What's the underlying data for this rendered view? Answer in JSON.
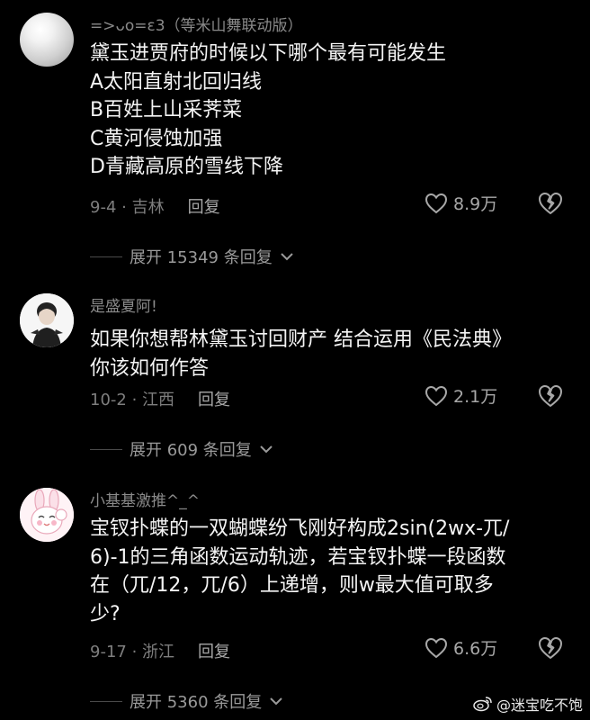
{
  "comments": [
    {
      "username": "=>ᴗo=ε3（等米山舞联动版）",
      "lines": [
        "黛玉进贾府的时候以下哪个最有可能发生",
        "A太阳直射北回归线",
        "B百姓上山采荠菜",
        "C黄河侵蚀加强",
        "D青藏高原的雪线下降"
      ],
      "date_location": "9-4 · 吉林",
      "reply_label": "回复",
      "likes": "8.9万",
      "expand_label": "展开 15349 条回复"
    },
    {
      "username": "是盛夏阿!",
      "lines": [
        "如果你想帮林黛玉讨回财产 结合运用《民法典》",
        "你该如何作答"
      ],
      "date_location": "10-2 · 江西",
      "reply_label": "回复",
      "likes": "2.1万",
      "expand_label": "展开 609 条回复"
    },
    {
      "username": "小基基激推^_^",
      "lines": [
        "宝钗扑蝶的一双蝴蝶纷飞刚好构成2sin(2wx-兀/",
        "6)-1的三角函数运动轨迹，若宝钗扑蝶一段函数",
        "在（兀/12，兀/6）上递增，则w最大值可取多",
        "少?"
      ],
      "date_location": "9-17 · 浙江",
      "reply_label": "回复",
      "likes": "6.6万",
      "expand_label": "展开 5360 条回复"
    }
  ],
  "watermark": "@迷宝吃不饱"
}
